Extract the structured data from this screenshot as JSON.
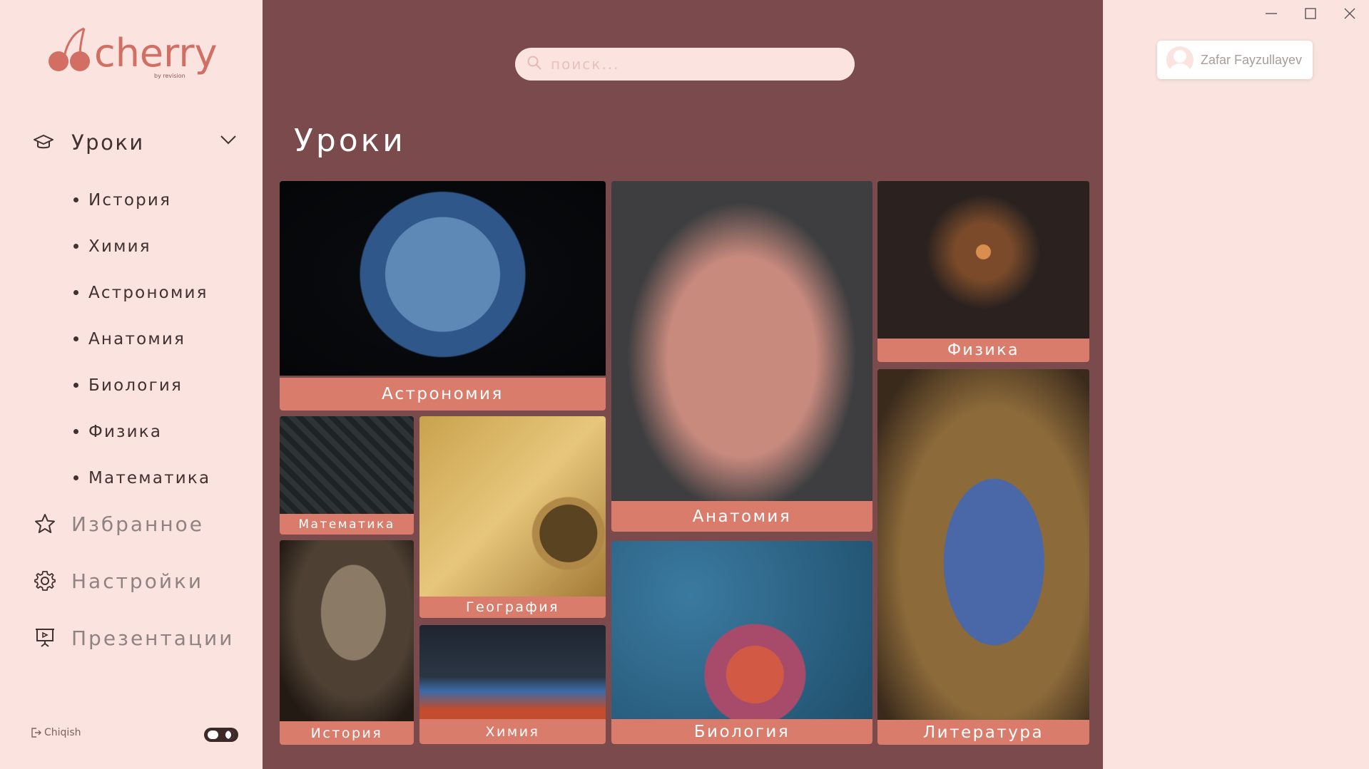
{
  "app": {
    "logo_text": "cherry",
    "logo_sub": "by revision"
  },
  "sidebar": {
    "lessons": {
      "label": "Уроки",
      "items": [
        "История",
        "Химия",
        "Астрономия",
        "Анатомия",
        "Биология",
        "Физика",
        "Математика"
      ]
    },
    "favorites_label": "Избранное",
    "settings_label": "Настройки",
    "presentations_label": "Презентации",
    "logout_label": "Chiqish"
  },
  "search": {
    "placeholder": "поиск..."
  },
  "main": {
    "title": "Уроки",
    "cards": {
      "astronomy": "Астрономия",
      "anatomy": "Анатомия",
      "physics": "Физика",
      "math": "Математика",
      "geography": "География",
      "history": "История",
      "chemistry": "Химия",
      "biology": "Биология",
      "literature": "Литература"
    }
  },
  "user": {
    "name": "Zafar Fayzullayev"
  },
  "colors": {
    "sidebar_bg": "#fbe3df",
    "main_bg": "#7b4a4c",
    "accent": "#d97c6c",
    "logo": "#d36e62"
  },
  "icons": {
    "lessons": "graduation-cap-icon",
    "favorites": "star-icon",
    "settings": "gear-icon",
    "presentations": "presentation-board-icon",
    "search": "search-icon",
    "logout": "logout-icon"
  }
}
